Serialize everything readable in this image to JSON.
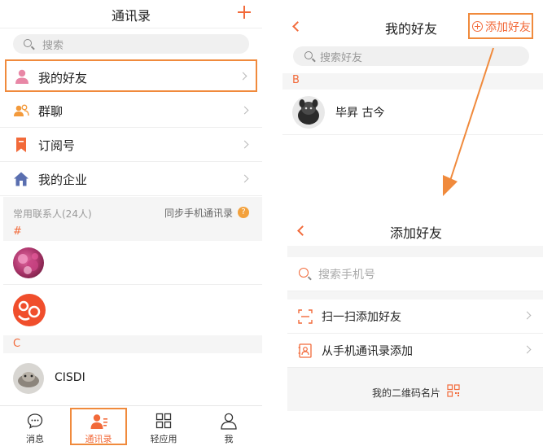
{
  "left": {
    "title": "通讯录",
    "search_placeholder": "搜索",
    "menu": [
      {
        "label": "我的好友",
        "icon": "person-icon",
        "color": "#e887a6"
      },
      {
        "label": "群聊",
        "icon": "group-icon",
        "color": "#f39a3b"
      },
      {
        "label": "订阅号",
        "icon": "bookmark-icon",
        "color": "#f26a3a"
      },
      {
        "label": "我的企业",
        "icon": "house-icon",
        "color": "#5a6fb0"
      }
    ],
    "frequent_header": "常用联系人(24人)",
    "sync_label": "同步手机通讯录",
    "sync_help": "?",
    "sections": [
      {
        "letter": "#"
      },
      {
        "letter": "C",
        "contact_name": "CISDI"
      }
    ],
    "tabs": [
      {
        "label": "消息",
        "icon": "chat-bubble-icon",
        "active": false
      },
      {
        "label": "通讯录",
        "icon": "contacts-icon",
        "active": true
      },
      {
        "label": "轻应用",
        "icon": "apps-grid-icon",
        "active": false
      },
      {
        "label": "我",
        "icon": "profile-icon",
        "active": false
      }
    ]
  },
  "friends": {
    "title": "我的好友",
    "add_button": "添加好友",
    "search_placeholder": "搜索好友",
    "section_letter": "B",
    "contact_name": "毕昇 古今"
  },
  "add_friend": {
    "title": "添加好友",
    "search_placeholder": "搜索手机号",
    "options": [
      {
        "label": "扫一扫添加好友",
        "icon": "scan-icon"
      },
      {
        "label": "从手机通讯录添加",
        "icon": "phone-contacts-icon"
      }
    ],
    "qr_label": "我的二维码名片",
    "qr_icon": "qr-code-icon"
  },
  "colors": {
    "accent": "#f26a3a",
    "highlight_border": "#f08a3c"
  }
}
